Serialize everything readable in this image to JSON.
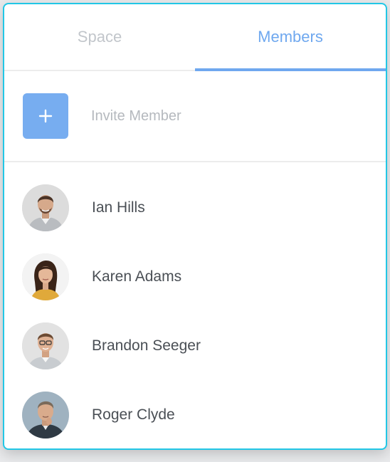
{
  "tabs": [
    {
      "label": "Space",
      "active": false
    },
    {
      "label": "Members",
      "active": true
    }
  ],
  "invite": {
    "label": "Invite Member",
    "icon": "plus-icon"
  },
  "members": [
    {
      "name": "Ian Hills",
      "avatar": "avatar-ian-hills"
    },
    {
      "name": "Karen Adams",
      "avatar": "avatar-karen-adams"
    },
    {
      "name": "Brandon Seeger",
      "avatar": "avatar-brandon-seeger"
    },
    {
      "name": "Roger Clyde",
      "avatar": "avatar-roger-clyde"
    }
  ],
  "colors": {
    "accent": "#6fa8ef",
    "invite_button": "#77adf0",
    "panel_border": "#22c7e6",
    "inactive_tab": "#c2c6cb",
    "member_text": "#4a4f55"
  }
}
